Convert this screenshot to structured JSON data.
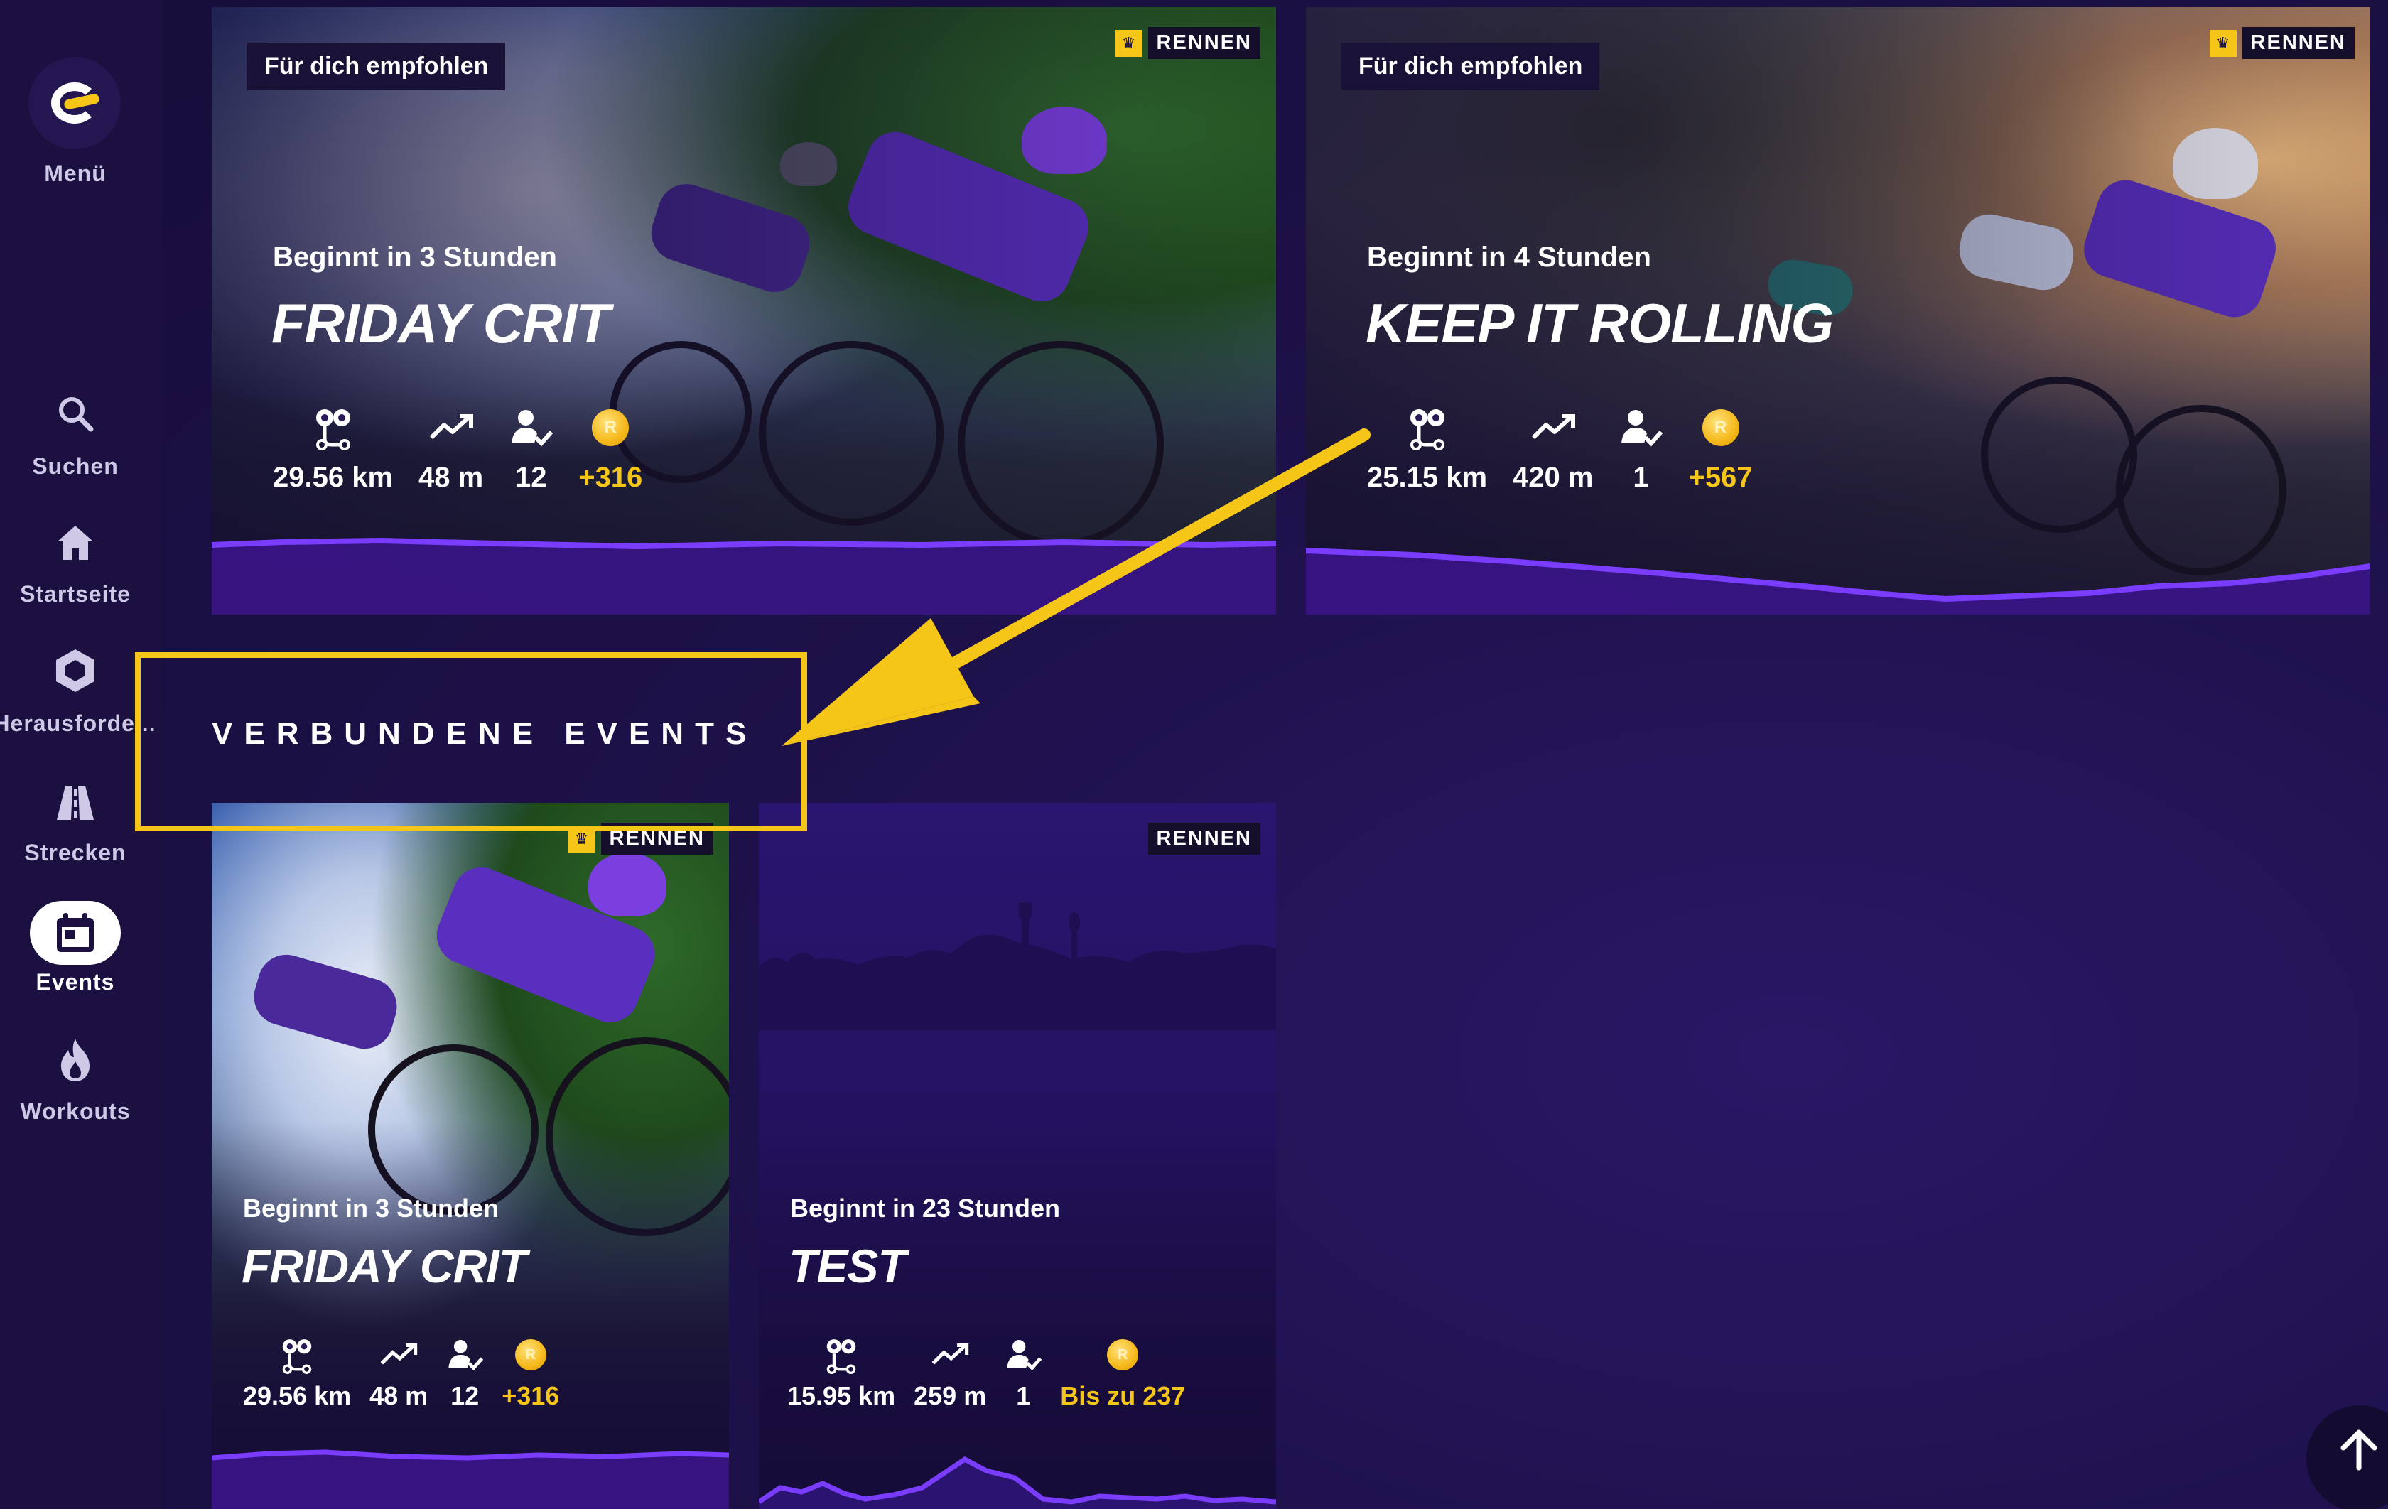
{
  "sidebar": {
    "menu_label": "Menü",
    "items": [
      {
        "label": "Suchen",
        "icon": "search-icon"
      },
      {
        "label": "Startseite",
        "icon": "home-icon"
      },
      {
        "label": "Herausforde...",
        "icon": "challenge-hexagon-icon"
      },
      {
        "label": "Strecken",
        "icon": "road-icon"
      },
      {
        "label": "Events",
        "icon": "calendar-icon",
        "active": true
      },
      {
        "label": "Workouts",
        "icon": "flame-icon"
      }
    ]
  },
  "featured": [
    {
      "chip": "Für dich empfohlen",
      "badge": "RENNEN",
      "starts": "Beginnt in 3 Stunden",
      "title": "FRIDAY CRIT",
      "distance": "29.56 km",
      "elevation": "48 m",
      "participants": "12",
      "coins": "+316"
    },
    {
      "chip": "Für dich empfohlen",
      "badge": "RENNEN",
      "starts": "Beginnt in 4 Stunden",
      "title": "KEEP IT ROLLING",
      "distance": "25.15 km",
      "elevation": "420 m",
      "participants": "1",
      "coins": "+567"
    }
  ],
  "section": {
    "title": "VERBUNDENE EVENTS"
  },
  "connected": [
    {
      "badge": "RENNEN",
      "starts": "Beginnt in 3 Stunden",
      "title": "FRIDAY CRIT",
      "distance": "29.56 km",
      "elevation": "48 m",
      "participants": "12",
      "coins": "+316"
    },
    {
      "badge": "RENNEN",
      "starts": "Beginnt in 23 Stunden",
      "title": "TEST",
      "distance": "15.95 km",
      "elevation": "259 m",
      "participants": "1",
      "coins": "Bis zu 237"
    }
  ],
  "colors": {
    "background": "#1d1149",
    "sidebar": "#1b1040",
    "accent_purple": "#6a2bff",
    "coin_gold": "#f5c518",
    "annotation_yellow": "#f5c518"
  },
  "annotation": {
    "type": "arrow-and-box",
    "target": "section-title"
  }
}
